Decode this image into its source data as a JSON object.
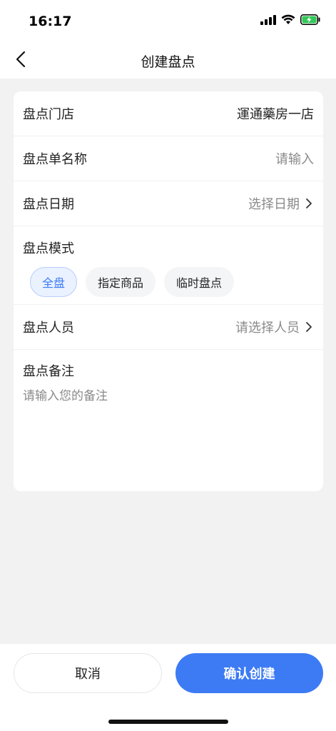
{
  "status_bar": {
    "time": "16:17",
    "icons": [
      "signal-icon",
      "wifi-icon",
      "battery-charging-icon"
    ]
  },
  "nav": {
    "back_icon": "chevron-left-icon",
    "title": "创建盘点"
  },
  "form": {
    "store": {
      "label": "盘点门店",
      "value": "運通藥房一店"
    },
    "name": {
      "label": "盘点单名称",
      "placeholder": "请输入"
    },
    "date": {
      "label": "盘点日期",
      "value": "选择日期",
      "icon": "chevron-right-icon"
    },
    "mode": {
      "label": "盘点模式",
      "options": [
        "全盘",
        "指定商品",
        "临时盘点"
      ],
      "selected": "全盘"
    },
    "staff": {
      "label": "盘点人员",
      "value": "请选择人员",
      "icon": "chevron-right-icon"
    },
    "note": {
      "label": "盘点备注",
      "placeholder": "请输入您的备注"
    }
  },
  "footer": {
    "cancel_label": "取消",
    "confirm_label": "确认创建"
  },
  "colors": {
    "accent": "#3d7bf5",
    "background": "#f2f2f2",
    "muted_text": "#8a8a8a",
    "chip_active_bg": "#eaf1ff"
  }
}
